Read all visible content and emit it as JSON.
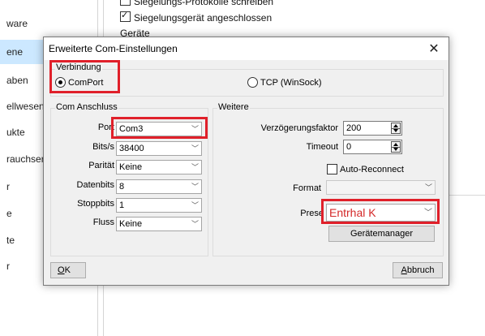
{
  "background": {
    "sidebar_items": [
      {
        "label": "ware"
      },
      {
        "label": "ene"
      },
      {
        "label": "aben"
      },
      {
        "label": "ellwesen"
      },
      {
        "label": "ukte"
      },
      {
        "label": "rauchserf"
      },
      {
        "label": "r"
      },
      {
        "label": "e"
      },
      {
        "label": "te"
      },
      {
        "label": "r"
      }
    ],
    "top_cut_text": "Siegelungs-Protokolle schreiben",
    "checkbox_label": "Siegelungsgerät angeschlossen",
    "section_label": "Geräte"
  },
  "dialog": {
    "title": "Erweiterte Com-Einstellungen",
    "close_symbol": "✕",
    "connection": {
      "group_label": "Verbindung",
      "comport_label": "ComPort",
      "tcp_label": "TCP (WinSock)",
      "selected": "ComPort"
    },
    "com_port": {
      "group_label": "Com Anschluss",
      "port_label": "Port",
      "port_value": "Com3",
      "baud_label": "Bits/s",
      "baud_value": "38400",
      "parity_label": "Parität",
      "parity_value": "Keine",
      "databits_label": "Datenbits",
      "databits_value": "8",
      "stopbits_label": "Stoppbits",
      "stopbits_value": "1",
      "flow_label": "Fluss",
      "flow_value": "Keine"
    },
    "further": {
      "group_label": "Weitere",
      "delay_label": "Verzögerungsfaktor",
      "delay_value": "200",
      "timeout_label": "Timeout",
      "timeout_value": "0",
      "auto_reconnect_label": "Auto-Reconnect",
      "auto_reconnect_checked": false,
      "format_label": "Format",
      "format_value": "",
      "preset_label": "Prese",
      "preset_value": "Entrhal K",
      "device_manager_label": "Gerätemanager"
    },
    "ok_prefix": "O",
    "ok_rest": "K",
    "cancel_prefix": "A",
    "cancel_rest": "bbruch"
  },
  "colors": {
    "highlight": "#e0202a",
    "selection": "#cce8ff",
    "dialog_bg": "#f0f0f0"
  }
}
